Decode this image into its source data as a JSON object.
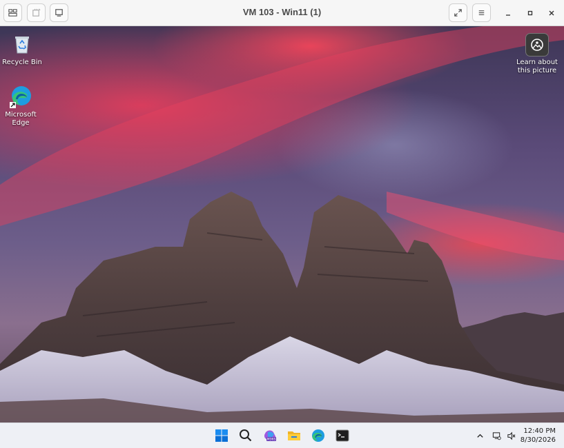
{
  "window": {
    "title": "VM 103 - Win11 (1)"
  },
  "desktop": {
    "icons": [
      {
        "label": "Recycle Bin",
        "icon": "recycle-bin-icon"
      },
      {
        "label": "Microsoft Edge",
        "icon": "edge-icon"
      }
    ],
    "spotlight": {
      "label": "Learn about this picture",
      "icon": "camera-spotlight-icon"
    }
  },
  "taskbar": {
    "apps": [
      "start-icon",
      "search-icon",
      "copilot-m365-icon",
      "file-explorer-icon",
      "edge-icon",
      "terminal-icon"
    ],
    "time": "12:40 PM",
    "date": "8/30/2026"
  },
  "colors": {
    "accent": "#0078d4",
    "sky_pink": "#f03c5a",
    "titlebar": "#f6f6f6"
  }
}
